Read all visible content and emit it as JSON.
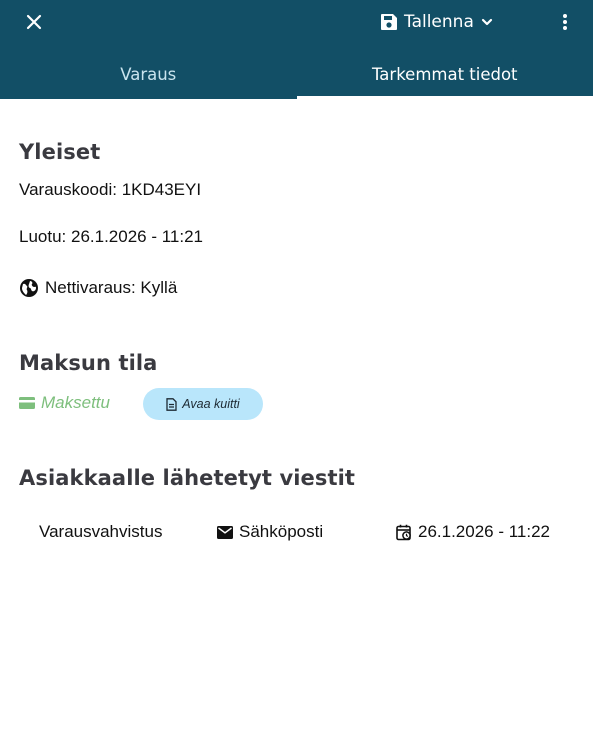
{
  "toolbar": {
    "close_icon": "close-icon",
    "save_label": "Tallenna",
    "save_icon": "floppy-disk-icon",
    "chevron_icon": "chevron-down-icon",
    "more_icon": "more-vertical-icon"
  },
  "tabs": [
    {
      "label": "Varaus",
      "active": false
    },
    {
      "label": "Tarkemmat tiedot",
      "active": true
    }
  ],
  "general": {
    "heading": "Yleiset",
    "booking_code": "Varauskoodi: 1KD43EYI",
    "created": "Luotu: 26.1.2026 - 11:21",
    "online_booking": "Nettivaraus: Kyllä",
    "online_icon": "globe-icon"
  },
  "payment": {
    "heading": "Maksun tila",
    "status": "Maksettu",
    "status_color": "#7ebf7d",
    "status_icon": "credit-card-icon",
    "receipt_button": "Avaa kuitti",
    "receipt_icon": "document-icon"
  },
  "messages": {
    "heading": "Asiakkaalle lähetetyt viestit",
    "rows": [
      {
        "type": "Varausvahvistus",
        "channel": "Sähköposti",
        "channel_icon": "email-icon",
        "timestamp": "26.1.2026 - 11:22",
        "time_icon": "calendar-clock-icon"
      }
    ]
  },
  "colors": {
    "appbar": "#124f66",
    "receipt_button_bg": "#b9e6fb",
    "heading": "#3a3a40"
  }
}
